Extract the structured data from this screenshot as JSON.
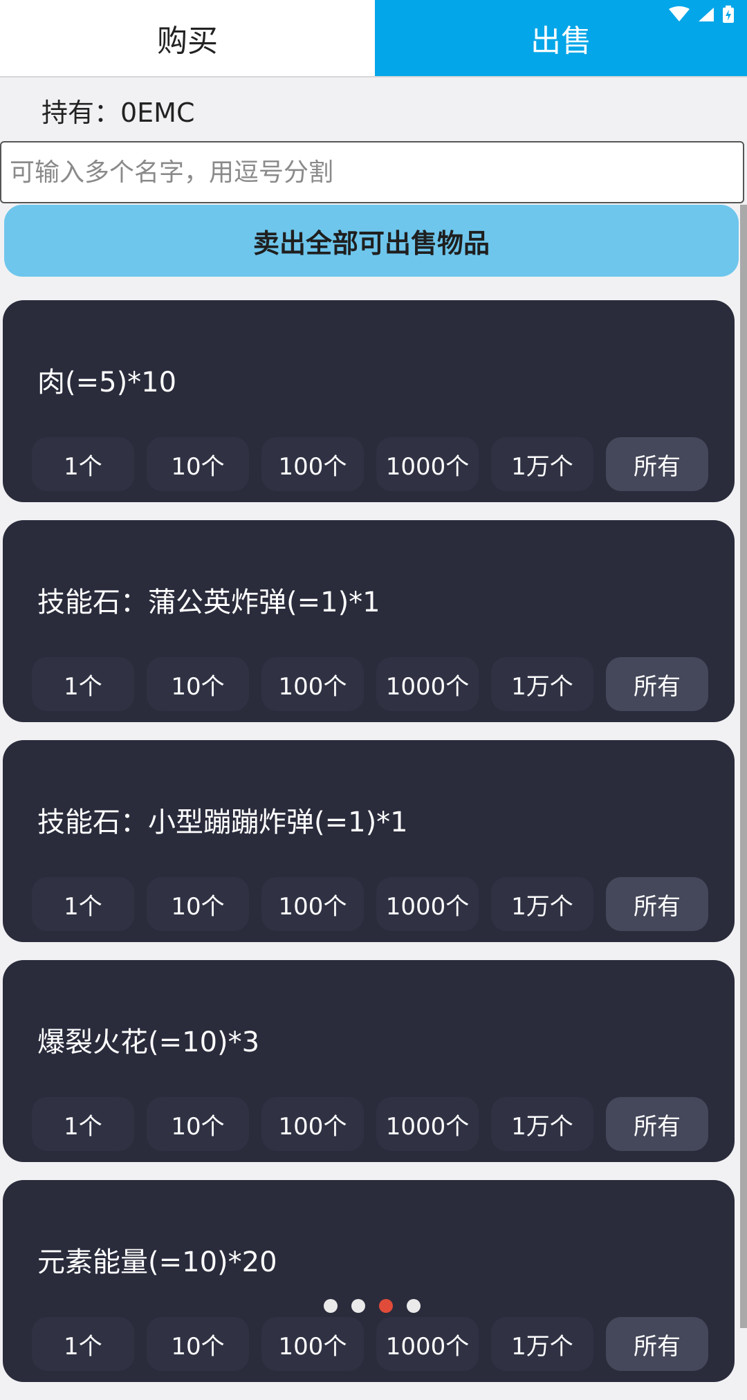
{
  "tabs": [
    {
      "label": "购买",
      "active": false
    },
    {
      "label": "出售",
      "active": true
    }
  ],
  "balance": "持有：0EMC",
  "search": {
    "placeholder": "可输入多个名字，用逗号分割",
    "value": ""
  },
  "sell_all_label": "卖出全部可出售物品",
  "quantity_buttons": [
    "1个",
    "10个",
    "100个",
    "1000个",
    "1万个",
    "所有"
  ],
  "items": [
    {
      "title": "肉(=5)*10"
    },
    {
      "title": "技能石：蒲公英炸弹(=1)*1"
    },
    {
      "title": "技能石：小型蹦蹦炸弹(=1)*1"
    },
    {
      "title": "爆裂火花(=10)*3"
    },
    {
      "title": "元素能量(=10)*20"
    }
  ],
  "page_indicator": {
    "count": 4,
    "active_index": 2
  },
  "colors": {
    "accent": "#03a6e8",
    "sell_all": "#6ec6ec",
    "card": "#2a2c3c",
    "dot_active": "#e14b3a"
  }
}
